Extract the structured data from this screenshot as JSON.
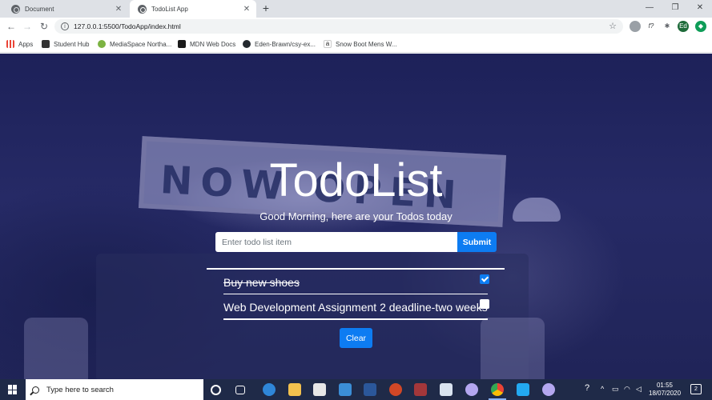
{
  "browser": {
    "tabs": [
      {
        "title": "Document",
        "close": "✕"
      },
      {
        "title": "TodoList App",
        "close": "✕"
      }
    ],
    "new_tab": "+",
    "window_controls": {
      "minimize": "—",
      "maximize": "❐",
      "close": "✕"
    },
    "url": "127.0.0.1:5500/TodoApp/index.html",
    "nav": {
      "back": "←",
      "forward": "→",
      "reload": "↻"
    },
    "profile_initials": "Ed",
    "extension_label": "f?",
    "bookmarks": [
      {
        "label": "Apps",
        "icon": "apps-grid-icon",
        "color": "#ea4335"
      },
      {
        "label": "Student Hub",
        "icon": "student-hub-icon",
        "color": "#333333"
      },
      {
        "label": "MediaSpace Northa...",
        "icon": "mediaspace-icon",
        "color": "#7cb342"
      },
      {
        "label": "MDN Web Docs",
        "icon": "mdn-icon",
        "color": "#1a1a1a"
      },
      {
        "label": "Eden-Brawn/csy-ex...",
        "icon": "github-icon",
        "color": "#24292e"
      },
      {
        "label": "Snow Boot Mens W...",
        "icon": "amazon-icon",
        "color": "#222222"
      }
    ]
  },
  "app": {
    "title": "TodoList",
    "subtitle": "Good Morning, here are your Todos today",
    "input_placeholder": "Enter todo list item",
    "submit_label": "Submit",
    "clear_label": "Clear",
    "background_sign": "NOW OPEN",
    "todos": [
      {
        "text": "Buy new shoes",
        "done": true
      },
      {
        "text": "Web Development Assignment 2 deadline-two weeks",
        "done": false
      }
    ]
  },
  "taskbar": {
    "search_placeholder": "Type here to search",
    "time": "01:55",
    "date": "18/07/2020",
    "notifications": "2",
    "pinned": [
      "cortana-icon",
      "task-view-icon",
      "edge-icon",
      "file-explorer-icon",
      "store-icon",
      "mail-icon",
      "word-icon",
      "powerpoint-icon",
      "access-icon",
      "app-icon",
      "teams-icon",
      "chrome-icon",
      "vscode-icon",
      "app-icon-2"
    ]
  },
  "colors": {
    "primary": "#0d7cf2",
    "page_bg": "#232760",
    "taskbar": "#1f2a48"
  }
}
